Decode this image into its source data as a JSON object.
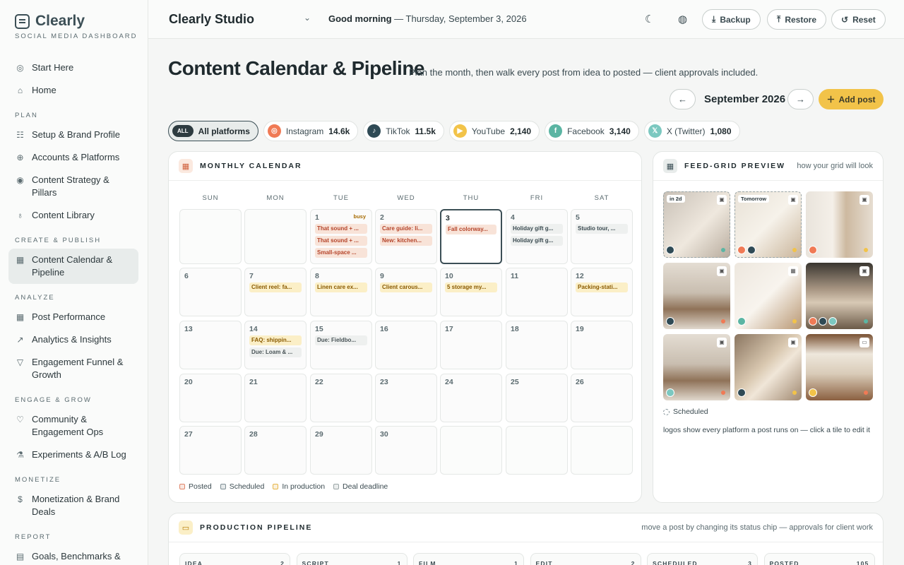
{
  "brand": {
    "name": "Clearly",
    "tagline": "SOCIAL MEDIA DASHBOARD"
  },
  "nav": {
    "top": [
      {
        "label": "Start Here",
        "icon": "compass-icon"
      },
      {
        "label": "Home",
        "icon": "home-icon"
      }
    ],
    "sections": [
      {
        "title": "PLAN",
        "items": [
          {
            "label": "Setup & Brand Profile",
            "icon": "sliders-icon"
          },
          {
            "label": "Accounts & Platforms",
            "icon": "globe-icon"
          },
          {
            "label": "Content Strategy & Pillars",
            "icon": "target-icon"
          },
          {
            "label": "Content Library",
            "icon": "bulb-icon"
          }
        ]
      },
      {
        "title": "CREATE & PUBLISH",
        "items": [
          {
            "label": "Content Calendar & Pipeline",
            "icon": "calendar-icon",
            "active": true
          }
        ]
      },
      {
        "title": "ANALYZE",
        "items": [
          {
            "label": "Post Performance",
            "icon": "grid-icon"
          },
          {
            "label": "Analytics & Insights",
            "icon": "trend-icon"
          },
          {
            "label": "Engagement Funnel & Growth",
            "icon": "funnel-icon"
          }
        ]
      },
      {
        "title": "ENGAGE & GROW",
        "items": [
          {
            "label": "Community & Engagement Ops",
            "icon": "heart-icon"
          },
          {
            "label": "Experiments & A/B Log",
            "icon": "flask-icon"
          }
        ]
      },
      {
        "title": "MONETIZE",
        "items": [
          {
            "label": "Monetization & Brand Deals",
            "icon": "dollar-icon"
          }
        ]
      },
      {
        "title": "REPORT",
        "items": [
          {
            "label": "Goals, Benchmarks &",
            "icon": "report-icon"
          }
        ]
      }
    ]
  },
  "topbar": {
    "workspace": "Clearly Studio",
    "greeting_bold": "Good morning",
    "greeting_rest": " — Thursday, September 3, 2026",
    "backup": "Backup",
    "restore": "Restore",
    "reset": "Reset"
  },
  "header": {
    "title": "Content Calendar & Pipeline",
    "subtitle": "Plan the month, then walk every post from idea to posted — client approvals included.",
    "month": "September 2026",
    "add_post": "Add post",
    "prev": "←",
    "next": "→"
  },
  "platforms": [
    {
      "name": "All platforms",
      "badge": "ALL",
      "selected": true
    },
    {
      "name": "Instagram",
      "count": "14.6k",
      "color": "#f07a55",
      "glyph": "◎"
    },
    {
      "name": "TikTok",
      "count": "11.5k",
      "color": "#2f4a55",
      "glyph": "♪"
    },
    {
      "name": "YouTube",
      "count": "2,140",
      "color": "#f2c349",
      "glyph": "▶"
    },
    {
      "name": "Facebook",
      "count": "3,140",
      "color": "#5bb5a3",
      "glyph": "f"
    },
    {
      "name": "X (Twitter)",
      "count": "1,080",
      "color": "#7cc8c0",
      "glyph": "𝕏"
    }
  ],
  "calendar": {
    "title": "MONTHLY CALENDAR",
    "dow": [
      "SUN",
      "MON",
      "TUE",
      "WED",
      "THU",
      "FRI",
      "SAT"
    ],
    "busy_label": "busy",
    "weeks": [
      [
        {
          "d": ""
        },
        {
          "d": ""
        },
        {
          "d": "1",
          "busy": true,
          "ev": [
            [
              "posted",
              "That sound + ..."
            ],
            [
              "posted",
              "That sound + ..."
            ],
            [
              "posted",
              "Small-space ..."
            ]
          ]
        },
        {
          "d": "2",
          "ev": [
            [
              "posted",
              "Care guide: li..."
            ],
            [
              "posted",
              "New: kitchen..."
            ]
          ]
        },
        {
          "d": "3",
          "today": true,
          "ev": [
            [
              "posted",
              "Fall colorway..."
            ]
          ]
        },
        {
          "d": "4",
          "ev": [
            [
              "sched",
              "Holiday gift g..."
            ],
            [
              "sched",
              "Holiday gift g..."
            ]
          ]
        },
        {
          "d": "5",
          "ev": [
            [
              "sched",
              "Studio tour, ..."
            ]
          ]
        }
      ],
      [
        {
          "d": "6"
        },
        {
          "d": "7",
          "ev": [
            [
              "prod",
              "Client reel: fa..."
            ]
          ]
        },
        {
          "d": "8",
          "ev": [
            [
              "prod",
              "Linen care ex..."
            ]
          ]
        },
        {
          "d": "9",
          "ev": [
            [
              "prod",
              "Client carous..."
            ]
          ]
        },
        {
          "d": "10",
          "ev": [
            [
              "prod",
              "5 storage my..."
            ]
          ]
        },
        {
          "d": "11"
        },
        {
          "d": "12",
          "ev": [
            [
              "prod",
              "Packing-stati..."
            ]
          ]
        }
      ],
      [
        {
          "d": "13"
        },
        {
          "d": "14",
          "ev": [
            [
              "prod",
              "FAQ: shippin..."
            ],
            [
              "deal",
              "Due: Loam & ..."
            ]
          ]
        },
        {
          "d": "15",
          "ev": [
            [
              "deal",
              "Due: Fieldbo..."
            ]
          ]
        },
        {
          "d": "16"
        },
        {
          "d": "17"
        },
        {
          "d": "18"
        },
        {
          "d": "19"
        }
      ],
      [
        {
          "d": "20"
        },
        {
          "d": "21"
        },
        {
          "d": "22"
        },
        {
          "d": "23"
        },
        {
          "d": "24"
        },
        {
          "d": "25"
        },
        {
          "d": "26"
        }
      ],
      [
        {
          "d": "27"
        },
        {
          "d": "28"
        },
        {
          "d": "29"
        },
        {
          "d": "30"
        },
        {
          "d": ""
        },
        {
          "d": ""
        },
        {
          "d": ""
        }
      ]
    ],
    "legend": [
      {
        "label": "Posted",
        "color": "#e0866a"
      },
      {
        "label": "Scheduled",
        "color": "#7f8f95"
      },
      {
        "label": "In production",
        "color": "#e6b64a"
      },
      {
        "label": "Deal deadline",
        "color": "#9aa5a6"
      }
    ]
  },
  "feed": {
    "title": "FEED-GRID PREVIEW",
    "hint": "how your grid will look",
    "scheduled_label": "Scheduled",
    "footer": "logos show every platform a post runs on — click a tile to edit it",
    "tiles": [
      {
        "tag": "in 2d",
        "bg": "linear-gradient(135deg,#c8c0b6,#efe8de 55%,#b7ab9d)",
        "dash": true,
        "pl": [
          "#2f4a55"
        ],
        "dot": "#5bb5a3",
        "type": "▣"
      },
      {
        "tag": "Tomorrow",
        "bg": "linear-gradient(135deg,#e8e1d6,#f6f2ea 50%,#c9b49a)",
        "dash": true,
        "pl": [
          "#f07a55",
          "#2f4a55"
        ],
        "dot": "#f2c349",
        "type": "▣"
      },
      {
        "tag": "",
        "bg": "linear-gradient(90deg,#e9e4dc,#f4efe8 40%,#cdb9a0 60%,#e6ddd1)",
        "pl": [
          "#f07a55"
        ],
        "dot": "#f2c349",
        "type": "▣"
      },
      {
        "tag": "",
        "bg": "linear-gradient(180deg,#e4ddd3,#c9beb0 45%,#8f7258 70%,#e0d8cd)",
        "pl": [
          "#2f4a55"
        ],
        "dot": "#f07a55",
        "type": "▣"
      },
      {
        "tag": "",
        "bg": "linear-gradient(135deg,#ede7de,#f8f4ee 50%,#b99874)",
        "pl": [
          "#5bb5a3"
        ],
        "dot": "#f2c349",
        "type": "▦"
      },
      {
        "tag": "",
        "bg": "linear-gradient(180deg,#3a3630,#a89683 40%,#d8c9b5 60%,#6b5a48)",
        "pl": [
          "#f07a55",
          "#2f4a55",
          "#7cc8c0"
        ],
        "dot": "#5bb5a3",
        "type": "▣"
      },
      {
        "tag": "",
        "bg": "linear-gradient(180deg,#e4ddd3,#c9beb0 45%,#8f7258 70%,#e0d8cd)",
        "pl": [
          "#7cc8c0"
        ],
        "dot": "#f07a55",
        "type": "▣"
      },
      {
        "tag": "",
        "bg": "linear-gradient(135deg,#8a7560,#d9c8b0 45%,#f0e6d8 60%,#a08870)",
        "pl": [
          "#2f4a55"
        ],
        "dot": "#f2c349",
        "type": "▣"
      },
      {
        "tag": "",
        "bg": "linear-gradient(180deg,#7a5234,#eee7dc 30%,#d9cbb8 60%,#8b6040)",
        "pl": [
          "#f2c349"
        ],
        "dot": "#f07a55",
        "type": "▭"
      }
    ]
  },
  "pipeline": {
    "title": "PRODUCTION PIPELINE",
    "hint": "move a post by changing its status chip — approvals for client work",
    "columns": [
      {
        "name": "IDEA",
        "count": "2"
      },
      {
        "name": "SCRIPT",
        "count": "1"
      },
      {
        "name": "FILM",
        "count": "1"
      },
      {
        "name": "EDIT",
        "count": "2"
      },
      {
        "name": "SCHEDULED",
        "count": "3"
      },
      {
        "name": "POSTED",
        "count": "105"
      }
    ]
  }
}
